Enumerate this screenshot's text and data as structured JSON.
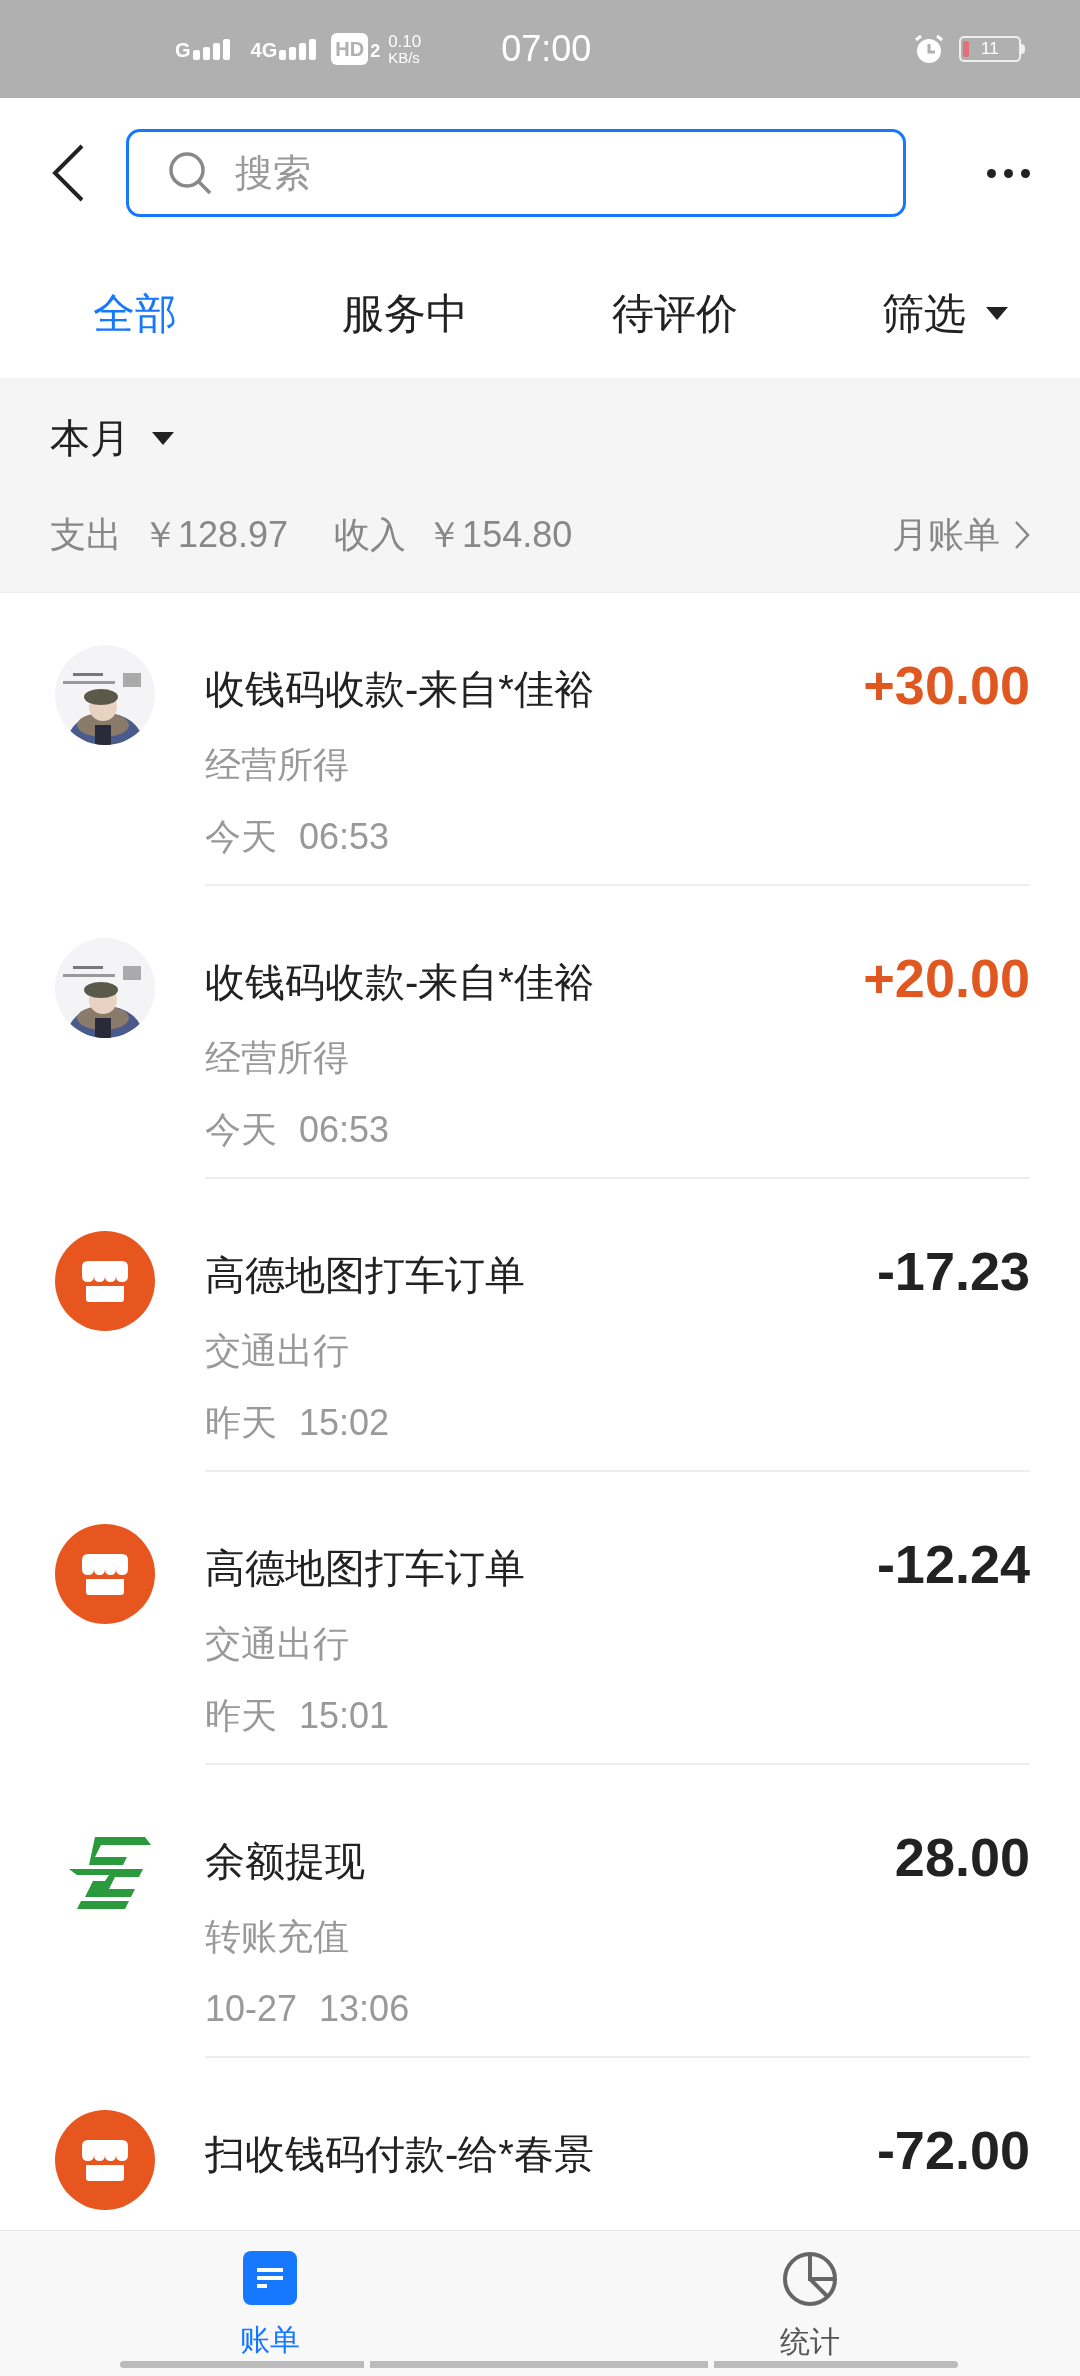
{
  "status_bar": {
    "signal_1": "G",
    "signal_2": "4G",
    "hd": "HD",
    "hd_sub": "2",
    "speed": "0.10",
    "speed_unit": "KB/s",
    "time": "07:00",
    "battery": "11"
  },
  "search": {
    "placeholder": "搜索"
  },
  "tabs": [
    {
      "label": "全部",
      "selected": true,
      "kind": "plain"
    },
    {
      "label": "服务中",
      "selected": false,
      "kind": "plain"
    },
    {
      "label": "待评价",
      "selected": false,
      "kind": "plain"
    },
    {
      "label": "筛选",
      "selected": false,
      "kind": "dropdown"
    }
  ],
  "summary": {
    "period": "本月",
    "expense_label": "支出",
    "expense": "￥128.97",
    "income_label": "收入",
    "income": "￥154.80",
    "link": "月账单"
  },
  "transactions": [
    {
      "kind": "avatar",
      "title": "收钱码收款-来自*佳裕",
      "category": "经营所得",
      "day": "今天",
      "time": "06:53",
      "amount": "+30.00",
      "income": true
    },
    {
      "kind": "avatar",
      "title": "收钱码收款-来自*佳裕",
      "category": "经营所得",
      "day": "今天",
      "time": "06:53",
      "amount": "+20.00",
      "income": true
    },
    {
      "kind": "shop",
      "title": "高德地图打车订单",
      "category": "交通出行",
      "day": "昨天",
      "time": "15:02",
      "amount": "-17.23",
      "income": false
    },
    {
      "kind": "shop",
      "title": "高德地图打车订单",
      "category": "交通出行",
      "day": "昨天",
      "time": "15:01",
      "amount": "-12.24",
      "income": false
    },
    {
      "kind": "post",
      "title": "余额提现",
      "category": "转账充值",
      "day": "10-27",
      "time": "13:06",
      "amount": "28.00",
      "income": false
    },
    {
      "kind": "shop",
      "title": "扫收钱码付款-给*春景",
      "amount": "-72.00",
      "income": false
    }
  ],
  "bottom_nav": [
    {
      "label": "账单",
      "kind": "bill",
      "selected": true
    },
    {
      "label": "统计",
      "kind": "chart",
      "selected": false
    }
  ]
}
